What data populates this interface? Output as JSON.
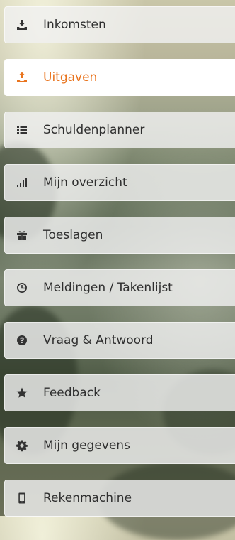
{
  "menu": {
    "items": [
      {
        "label": "Inkomsten",
        "icon": "inbox-in-icon"
      },
      {
        "label": "Uitgaven",
        "icon": "inbox-out-icon",
        "active": true
      },
      {
        "label": "Schuldenplanner",
        "icon": "list-icon"
      },
      {
        "label": "Mijn overzicht",
        "icon": "signal-bars-icon"
      },
      {
        "label": "Toeslagen",
        "icon": "gift-icon"
      },
      {
        "label": "Meldingen / Takenlijst",
        "icon": "clock-icon"
      },
      {
        "label": "Vraag & Antwoord",
        "icon": "question-circle-icon"
      },
      {
        "label": "Feedback",
        "icon": "star-icon"
      },
      {
        "label": "Mijn gegevens",
        "icon": "gear-icon"
      },
      {
        "label": "Rekenmachine",
        "icon": "mobile-icon"
      }
    ]
  },
  "colors": {
    "active_text": "#e9741e",
    "item_text": "#2f2f2f",
    "item_bg": "rgba(240,240,240,0.82)",
    "active_bg": "#ffffff"
  }
}
